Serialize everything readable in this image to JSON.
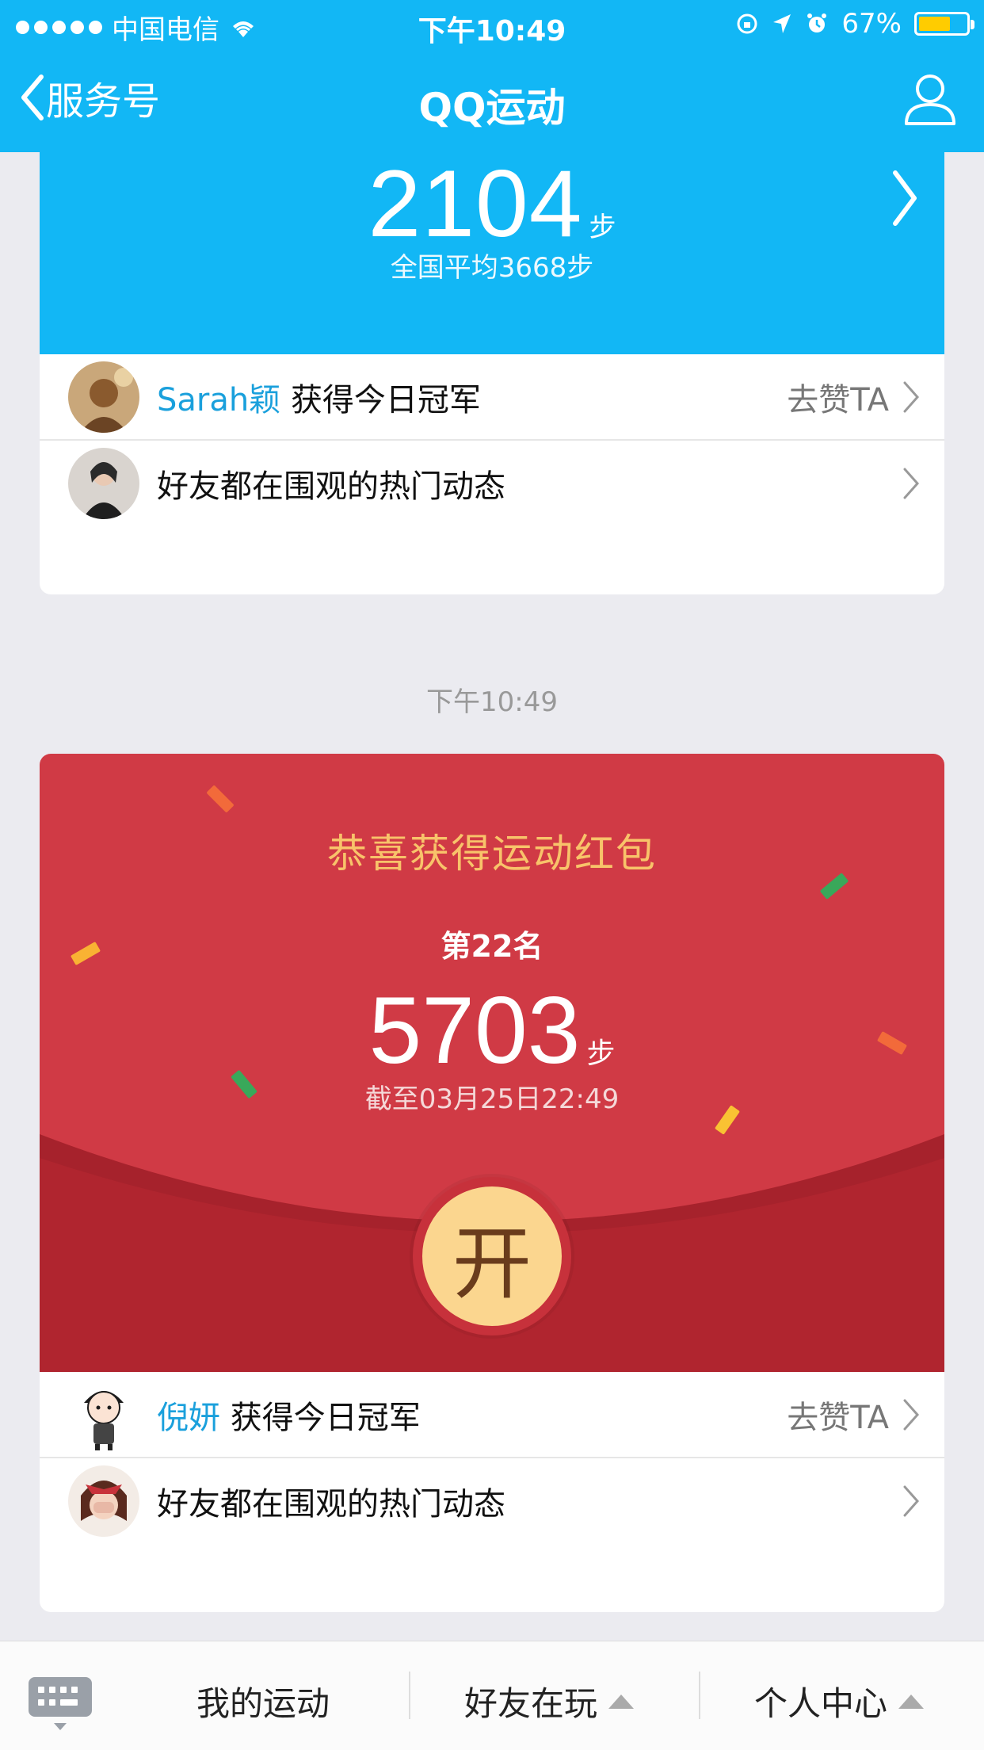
{
  "status_bar": {
    "carrier": "中国电信",
    "time": "下午10:49",
    "battery": "67%",
    "battery_level": 0.67
  },
  "nav": {
    "back_label": "服务号",
    "title": "QQ运动"
  },
  "my_steps": {
    "count": "2104",
    "unit": "步",
    "national_average": "全国平均3668步"
  },
  "card1_rows": {
    "champion_name": "Sarah颖",
    "champion_text": "获得今日冠军",
    "like_action": "去赞TA",
    "hot_text": "好友都在围观的热门动态"
  },
  "timestamp": "下午10:49",
  "red_packet": {
    "title": "恭喜获得运动红包",
    "rank": "第22名",
    "steps": "5703",
    "unit": "步",
    "as_of": "截至03月25日22:49",
    "open_label": "开",
    "colors": {
      "background": "#d03a45",
      "title": "#f8c36a",
      "button": "#fbd68f"
    }
  },
  "card2_rows": {
    "champion_name": "倪妍",
    "champion_text": "获得今日冠军",
    "like_action": "去赞TA",
    "hot_text": "好友都在围观的热门动态"
  },
  "bottom_bar": {
    "tabs": [
      "我的运动",
      "好友在玩",
      "个人中心"
    ]
  },
  "colors": {
    "brand_blue": "#12b7f5",
    "highlight_name": "#1aa0dc"
  }
}
